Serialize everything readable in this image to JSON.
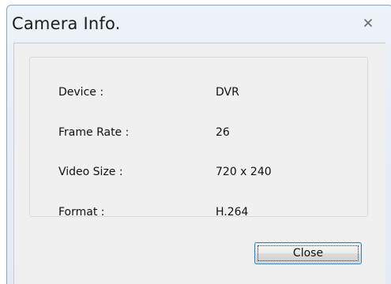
{
  "window": {
    "title": "Camera Info.",
    "close_icon": "close-x-icon"
  },
  "info": {
    "rows": [
      {
        "label": "Device :",
        "value": "DVR"
      },
      {
        "label": "Frame Rate :",
        "value": "26"
      },
      {
        "label": "Video Size :",
        "value": "720 x 240"
      },
      {
        "label": "Format :",
        "value": "H.264"
      }
    ]
  },
  "buttons": {
    "close_label": "Close"
  }
}
